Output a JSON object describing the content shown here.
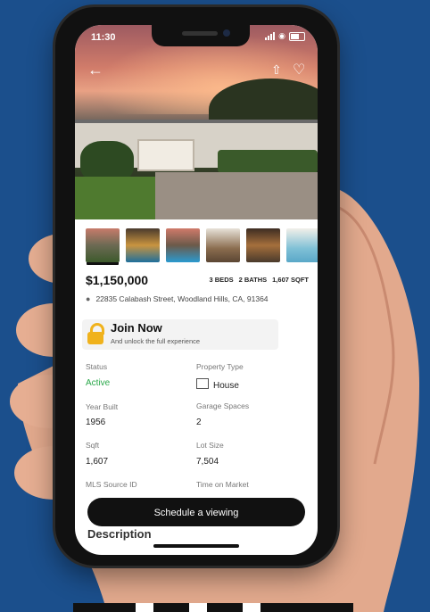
{
  "status_bar": {
    "time": "11:30"
  },
  "header": {
    "back_icon": "arrow-left-icon",
    "share_icon": "share-icon",
    "favorite_icon": "heart-icon"
  },
  "gallery": {
    "thumbnail_count": 6,
    "active_index": 0
  },
  "listing": {
    "price": "$1,150,000",
    "beds": "3 BEDS",
    "baths": "2 BATHS",
    "sqft": "1,607 SQFT",
    "address": "22835 Calabash Street, Woodland Hills, CA, 91364"
  },
  "join": {
    "title": "Join Now",
    "subtitle": "And unlock the full experience"
  },
  "details": {
    "status_label": "Status",
    "status_value": "Active",
    "property_type_label": "Property Type",
    "property_type_value": "House",
    "year_built_label": "Year Built",
    "year_built_value": "1956",
    "garage_label": "Garage Spaces",
    "garage_value": "2",
    "sqft_label": "Sqft",
    "sqft_value": "1,607",
    "lot_label": "Lot Size",
    "lot_value": "7,504",
    "mls_label": "MLS Source ID",
    "time_on_market_label": "Time on Market"
  },
  "cta": {
    "schedule_label": "Schedule a viewing"
  },
  "description": {
    "heading": "Description"
  },
  "colors": {
    "background": "#1b4f8c",
    "active_status": "#2aa84a",
    "lock": "#f0b21c",
    "button": "#111111"
  }
}
